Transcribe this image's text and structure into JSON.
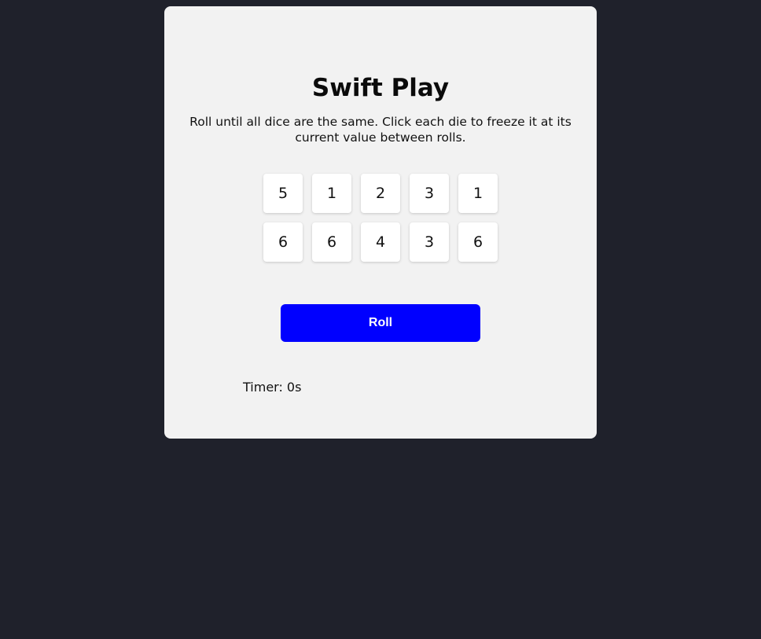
{
  "game": {
    "title": "Swift Play",
    "instructions": "Roll until all dice are the same. Click each die to freeze it at its current value between rolls.",
    "dice": [
      "5",
      "1",
      "2",
      "3",
      "1",
      "6",
      "6",
      "4",
      "3",
      "6"
    ],
    "roll_label": "Roll",
    "timer_label": "Timer: 0s"
  },
  "colors": {
    "background": "#1f212b",
    "card": "#f2f2f2",
    "roll_button": "#0000ff"
  }
}
